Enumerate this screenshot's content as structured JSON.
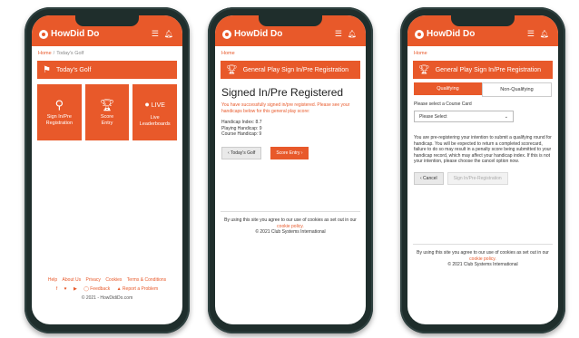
{
  "brand": "HowDid Do",
  "icons": {
    "menu": "hamburger-menu-icon",
    "bell": "bell-icon",
    "flag": "flag-icon",
    "pin": "location-pin-icon",
    "trophy": "trophy-icon",
    "live": "live-dot-icon"
  },
  "colors": {
    "accent": "#e8592a"
  },
  "phone1": {
    "breadcrumb": {
      "home": "Home",
      "sep": "/",
      "current": "Today's Golf"
    },
    "banner": "Today's Golf",
    "tiles": [
      {
        "label1": "Sign In/Pre",
        "label2": "Registration"
      },
      {
        "label1": "Score",
        "label2": "Entry"
      },
      {
        "live": "LIVE",
        "label1": "Live",
        "label2": "Leaderboards"
      }
    ],
    "footer": {
      "links": [
        "Help",
        "About Us",
        "Privacy",
        "Cookies",
        "Terms & Conditions"
      ],
      "social": [
        "f",
        "♥",
        "▶",
        "◯ Feedback",
        "▲ Report a Problem"
      ],
      "copyright": "© 2021 - HowDidiDo.com"
    }
  },
  "phone2": {
    "breadcrumb": "Home",
    "banner": "General Play Sign In/Pre Registration",
    "heading": "Signed In/Pre Registered",
    "message": "You have successfully signed in/pre registered. Please see your handicaps below for this general play score:",
    "handicaps": [
      "Handicap Index: 8.7",
      "Playing Handicap: 9",
      "Course Handicap: 9"
    ],
    "back_button": "‹ Today's Golf",
    "score_button": "Score Entry ›",
    "cookie_text": "By using this site you agree to our use of cookies as set out in our",
    "cookie_link": "cookie policy.",
    "copyright": "© 2021 Club Systems International"
  },
  "phone3": {
    "breadcrumb": "Home",
    "banner": "General Play Sign In/Pre Registration",
    "qualifying": "Qualifying",
    "non_qualifying": "Non-Qualifying",
    "select_label": "Please select a Course Card",
    "select_value": "Please Select",
    "paragraph": "You are pre-registering your intention to submit a qualifying round for handicap. You will be expected to return a completed scorecard, failure to do so may result in a penalty score being submitted to your handicap record, which may affect your handicap index. If this is not your intention, please choose the cancel option now.",
    "cancel_button": "‹ Cancel",
    "signin_button": "Sign In/Pre-Registration",
    "cookie_text": "By using this site you agree to our use of cookies as set out in our",
    "cookie_link": "cookie policy.",
    "copyright": "© 2021 Club Systems International"
  }
}
